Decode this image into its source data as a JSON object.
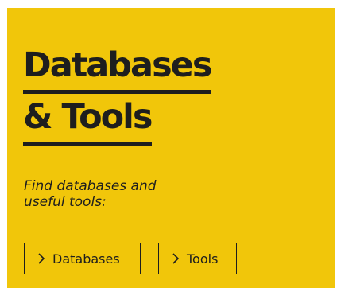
{
  "panel": {
    "background_color": "#f1c60a",
    "text_color": "#1e1e1e"
  },
  "heading": {
    "line1": "Databases",
    "line2": "& Tools"
  },
  "tagline": {
    "line1": "Find databases and",
    "line2": "useful tools:"
  },
  "buttons": [
    {
      "label": "Databases",
      "icon": "chevron-right-icon"
    },
    {
      "label": "Tools",
      "icon": "chevron-right-icon"
    }
  ]
}
